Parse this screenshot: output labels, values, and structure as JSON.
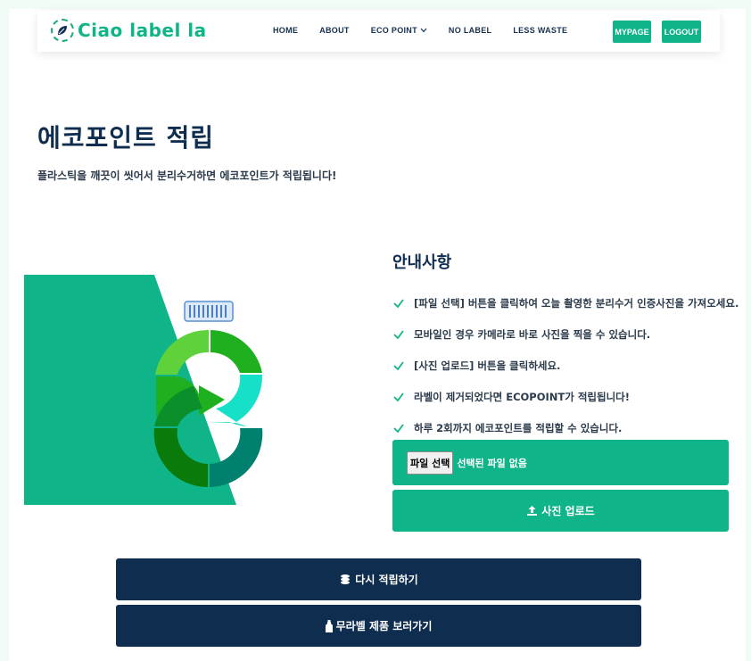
{
  "header": {
    "logo_text": "Ciao label la",
    "menu": [
      {
        "label": "HOME"
      },
      {
        "label": "ABOUT"
      },
      {
        "label": "ECO POINT"
      },
      {
        "label": "NO LABEL"
      },
      {
        "label": "LESS WASTE"
      }
    ],
    "mypage_label": "MYPAGE",
    "logout_label": "LOGOUT"
  },
  "page": {
    "title": "에코포인트 적립",
    "subtitle": "플라스틱을 깨끗이 씻어서 분리수거하면 에코포인트가 적립됩니다!"
  },
  "info": {
    "title": "안내사항",
    "items": [
      "[파일 선택] 버튼을 클릭하여 오늘 촬영한 분리수거 인증사진을 가져오세요.",
      "모바일인 경우 카메라로 바로 사진을 찍을 수 있습니다.",
      "[사진 업로드] 버튼을 클릭하세요.",
      "라벨이 제거되었다면 ECOPOINT가 적립됩니다!",
      "하루 2회까지 에코포인트를 적립할 수 있습니다."
    ]
  },
  "upload": {
    "file_button_label": "파일 선택",
    "file_status": "선택된 파일 없음",
    "upload_button_label": "사진 업로드"
  },
  "actions": {
    "retry_label": "다시 적립하기",
    "shop_label": "무라벨 제품 보러가기"
  },
  "colors": {
    "accent": "#0fb488",
    "navy": "#0e2d4f",
    "background": "#f0fcf5"
  }
}
